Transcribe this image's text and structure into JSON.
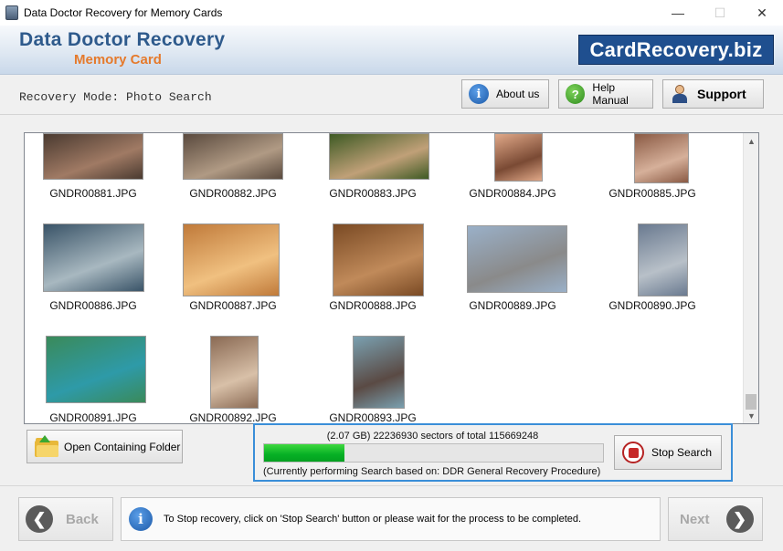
{
  "window": {
    "title": "Data Doctor Recovery for Memory Cards",
    "minimize_icon": "minimize-icon",
    "maximize_icon": "maximize-icon",
    "close_icon": "close-icon",
    "minimize_glyph": "—",
    "maximize_glyph": "☐",
    "close_glyph": "✕"
  },
  "banner": {
    "title": "Data Doctor Recovery",
    "subtitle": "Memory Card",
    "logo": "CardRecovery.biz"
  },
  "mode": {
    "text": "Recovery Mode: Photo Search"
  },
  "toolbar": {
    "about_label": "About us",
    "help_label": "Help Manual",
    "support_label": "Support",
    "about_glyph": "i",
    "help_glyph": "?"
  },
  "gallery": {
    "files": [
      {
        "name": "GNDR00881.JPG",
        "colors": [
          "#4a3a30",
          "#a07a64"
        ]
      },
      {
        "name": "GNDR00882.JPG",
        "colors": [
          "#5a4a3e",
          "#b09a84"
        ]
      },
      {
        "name": "GNDR00883.JPG",
        "colors": [
          "#3e5a24",
          "#c0a078"
        ]
      },
      {
        "name": "GNDR00884.JPG",
        "colors": [
          "#e0a888",
          "#7a4a34"
        ]
      },
      {
        "name": "GNDR00885.JPG",
        "colors": [
          "#8a5a44",
          "#d6b09a"
        ]
      },
      {
        "name": "GNDR00886.JPG",
        "colors": [
          "#3a5468",
          "#a8b8c0"
        ]
      },
      {
        "name": "GNDR00887.JPG",
        "colors": [
          "#c07a3a",
          "#f0c080"
        ]
      },
      {
        "name": "GNDR00888.JPG",
        "colors": [
          "#7a4a24",
          "#c08a5a"
        ]
      },
      {
        "name": "GNDR00889.JPG",
        "colors": [
          "#9ab0c8",
          "#8a8a8a"
        ]
      },
      {
        "name": "GNDR00890.JPG",
        "colors": [
          "#6a7a90",
          "#b8c0c8"
        ]
      },
      {
        "name": "GNDR00891.JPG",
        "colors": [
          "#3a8a5a",
          "#2e9aa8"
        ]
      },
      {
        "name": "GNDR00892.JPG",
        "colors": [
          "#8a6a54",
          "#d8c0a8"
        ]
      },
      {
        "name": "GNDR00893.JPG",
        "colors": [
          "#7aa0b0",
          "#5a4a44"
        ]
      }
    ],
    "scroll_up_glyph": "▲",
    "scroll_down_glyph": "▼"
  },
  "actions": {
    "open_folder_label": "Open Containing Folder"
  },
  "progress": {
    "info": "(2.07 GB) 22236930  sectors  of  total 115669248",
    "fraction": 0.2384,
    "caption": "(Currently performing Search based on:  DDR General Recovery Procedure)",
    "stop_label": "Stop Search",
    "fill_color": "#06b025"
  },
  "footer": {
    "back_label": "Back",
    "next_label": "Next",
    "back_glyph": "❮",
    "next_glyph": "❯",
    "hint": "To Stop recovery, click on 'Stop Search' button or please wait for the process to be completed.",
    "info_glyph": "i"
  }
}
